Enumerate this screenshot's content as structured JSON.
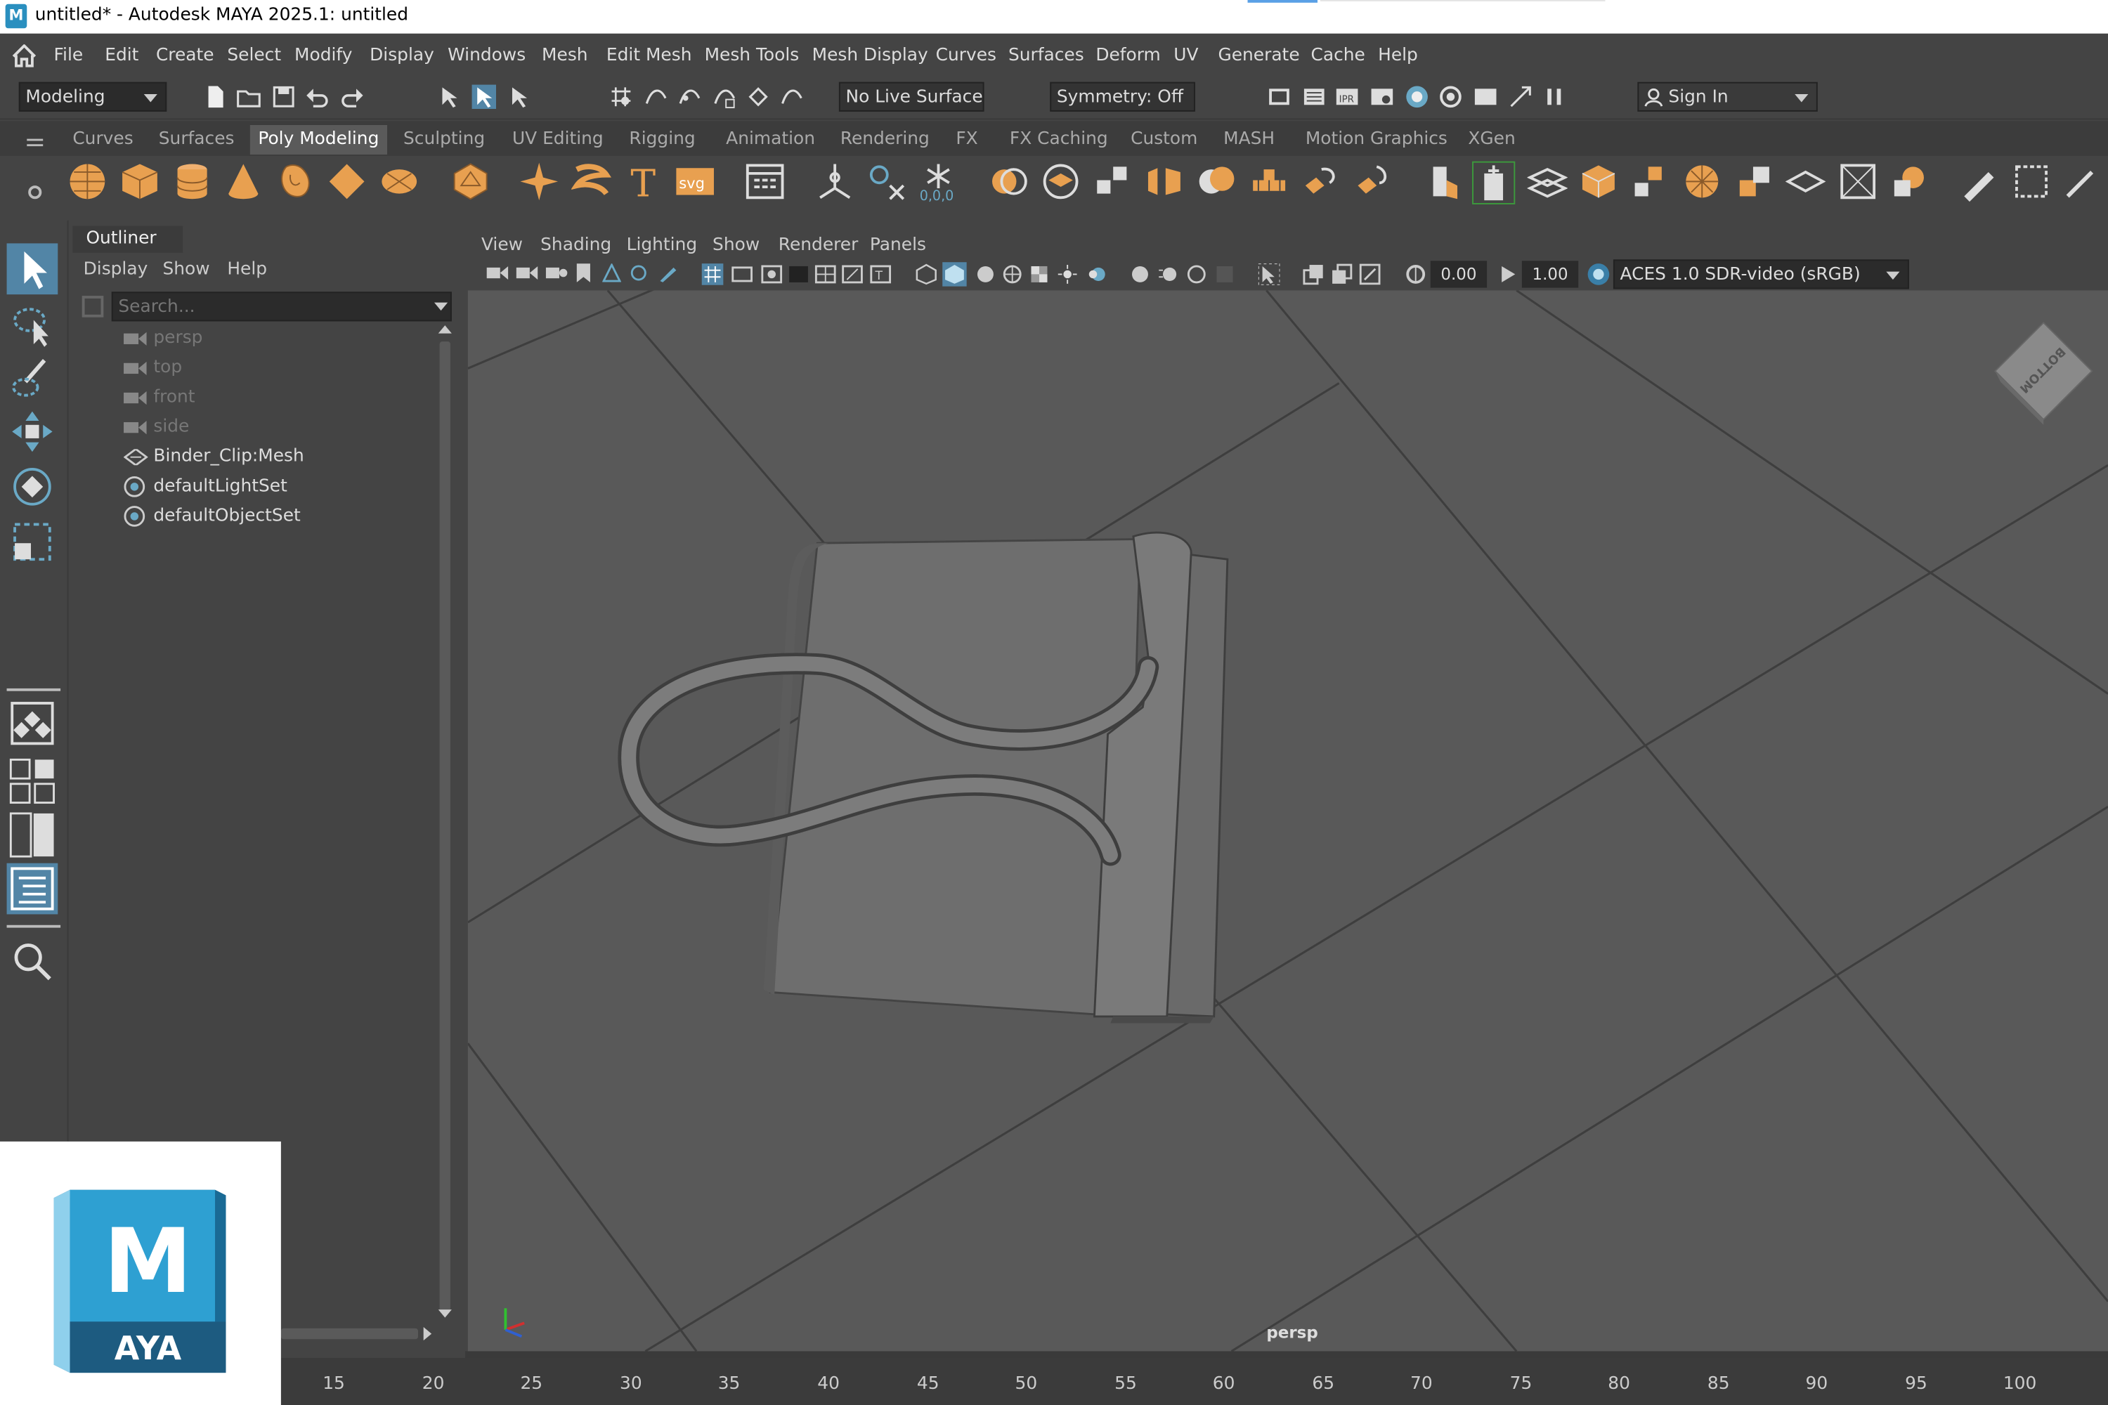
{
  "window": {
    "title": "untitled* - Autodesk MAYA 2025.1: untitled",
    "logo_letter": "M"
  },
  "menubar": {
    "items": [
      "File",
      "Edit",
      "Create",
      "Select",
      "Modify",
      "Display",
      "Windows",
      "Mesh",
      "Edit Mesh",
      "Mesh Tools",
      "Mesh Display",
      "Curves",
      "Surfaces",
      "Deform",
      "UV",
      "Generate",
      "Cache",
      "Help"
    ]
  },
  "statusline": {
    "menuset": "Modeling",
    "live_surface": "No Live Surface",
    "symmetry": "Symmetry: Off",
    "sign_in": "Sign In"
  },
  "shelf": {
    "tabs": [
      "Curves",
      "Surfaces",
      "Poly Modeling",
      "Sculpting",
      "UV Editing",
      "Rigging",
      "Animation",
      "Rendering",
      "FX",
      "FX Caching",
      "Custom",
      "MASH",
      "Motion Graphics",
      "XGen"
    ],
    "active_tab": "Poly Modeling",
    "svg_label": "svg",
    "type_label": "T",
    "snap_label": "0,0,0"
  },
  "outliner": {
    "title": "Outliner",
    "menu": [
      "Display",
      "Show",
      "Help"
    ],
    "search_placeholder": "Search...",
    "items": [
      {
        "label": "persp",
        "icon": "camera-icon",
        "dim": true
      },
      {
        "label": "top",
        "icon": "camera-icon",
        "dim": true
      },
      {
        "label": "front",
        "icon": "camera-icon",
        "dim": true
      },
      {
        "label": "side",
        "icon": "camera-icon",
        "dim": true
      },
      {
        "label": "Binder_Clip:Mesh",
        "icon": "mesh-icon",
        "dim": false
      },
      {
        "label": "defaultLightSet",
        "icon": "set-icon",
        "dim": false
      },
      {
        "label": "defaultObjectSet",
        "icon": "set-icon",
        "dim": false
      }
    ]
  },
  "viewport": {
    "menu": [
      "View",
      "Shading",
      "Lighting",
      "Show",
      "Renderer",
      "Panels"
    ],
    "exposure": "0.00",
    "gamma": "1.00",
    "color_space": "ACES 1.0 SDR-video (sRGB)",
    "camera_label": "persp",
    "viewcube_label": "BOTTOM"
  },
  "timeline": {
    "ticks": [
      "15",
      "20",
      "25",
      "30",
      "35",
      "40",
      "45",
      "50",
      "55",
      "60",
      "65",
      "70",
      "75",
      "80",
      "85",
      "90",
      "95",
      "100"
    ]
  },
  "brand": {
    "letter": "M",
    "name": "AYA"
  },
  "colors": {
    "shelf_orange": "#e8a050",
    "accent_blue": "#5285a6",
    "viewport_bg": "#595959"
  }
}
